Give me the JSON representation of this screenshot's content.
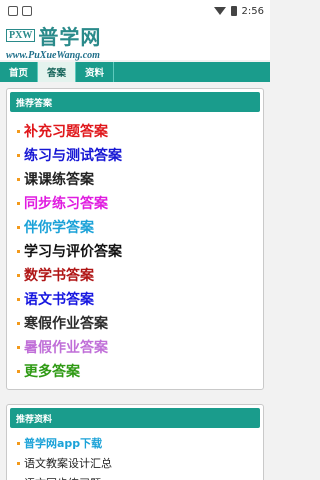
{
  "status": {
    "time": "2:56"
  },
  "site": {
    "logo_box": "PXW",
    "logo_name": "普学网",
    "logo_url": "www.PuXueWang.com"
  },
  "nav": [
    {
      "label": "首页"
    },
    {
      "label": "答案"
    },
    {
      "label": "资料"
    }
  ],
  "answers_panel": {
    "title": "推荐答案",
    "items": [
      {
        "label": "补充习题答案",
        "color": "#e0171b"
      },
      {
        "label": "练习与测试答案",
        "color": "#1717d4"
      },
      {
        "label": "课课练答案",
        "color": "#222222"
      },
      {
        "label": "同步练习答案",
        "color": "#e01ce0"
      },
      {
        "label": "伴你学答案",
        "color": "#1ba2d8"
      },
      {
        "label": "学习与评价答案",
        "color": "#111111"
      },
      {
        "label": "数学书答案",
        "color": "#b01515"
      },
      {
        "label": "语文书答案",
        "color": "#1717e0"
      },
      {
        "label": "寒假作业答案",
        "color": "#2b2b2b"
      },
      {
        "label": "暑假作业答案",
        "color": "#c06fd8"
      },
      {
        "label": "更多答案",
        "color": "#2f9a14"
      }
    ]
  },
  "resources_panel": {
    "title": "推荐资料",
    "items": [
      {
        "label": "普学网app下载",
        "color": "#1ba2d8"
      },
      {
        "label": "语文教案设计汇总",
        "color": "#222222"
      },
      {
        "label": "语文同步练习题",
        "color": "#222222"
      }
    ]
  }
}
